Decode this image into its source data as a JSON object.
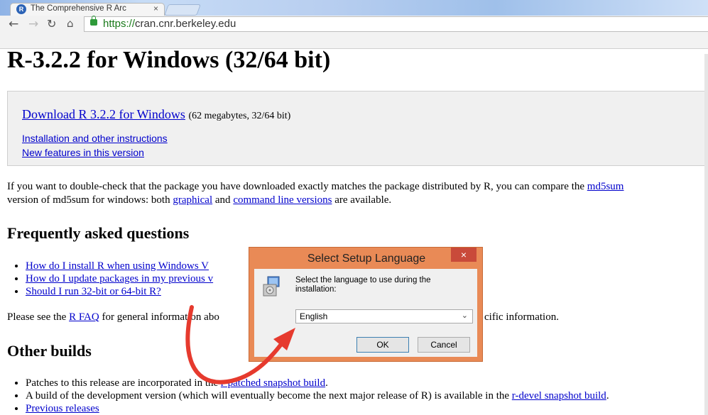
{
  "browser": {
    "tab_title": "The Comprehensive R Arc",
    "tab_close": "×",
    "url_scheme": "https://",
    "url_host": "cran.cnr.berkeley.edu"
  },
  "page": {
    "heading": "R-3.2.2 for Windows (32/64 bit)",
    "download": {
      "link": "Download R 3.2.2 for Windows",
      "note": "(62 megabytes, 32/64 bit)",
      "install_link": "Installation and other instructions",
      "features_link": "New features in this version"
    },
    "md5": {
      "line1_text": "If you want to double-check that the package you have downloaded exactly matches the package distributed by R, you can compare the ",
      "line1_link": "md5sum",
      "line2_a": "version of md5sum for windows: both ",
      "graphical": "graphical",
      "line2_b": " and ",
      "cmdline": "command line versions",
      "line2_c": " are available."
    },
    "faq": {
      "heading": "Frequently asked questions",
      "items": [
        "How do I install R when using Windows V",
        "How do I update packages in my previous v",
        "Should I run 32-bit or 64-bit R?"
      ],
      "see_a": "Please see the ",
      "rfaq": "R FAQ",
      "see_b": " for general inf",
      "see_c": "ormation abo",
      "see_d": "cific information."
    },
    "other": {
      "heading": "Other builds",
      "item1_a": "Patches to this release are incorporated in the ",
      "item1_link": "r-patched snapshot build",
      "item1_b": ".",
      "item2_a": "A build of the development version (which will eventually become the next major release of R) is available in the ",
      "item2_link": "r-devel snapshot build",
      "item2_b": ".",
      "item3_link": "Previous releases"
    }
  },
  "dialog": {
    "title": "Select Setup Language",
    "close": "×",
    "prompt": "Select the language to use during the installation:",
    "selected_language": "English",
    "ok": "OK",
    "cancel": "Cancel"
  },
  "colors": {
    "link": "#0000cc",
    "dialog_frame": "#e98a56",
    "arrow": "#e63a2e"
  }
}
